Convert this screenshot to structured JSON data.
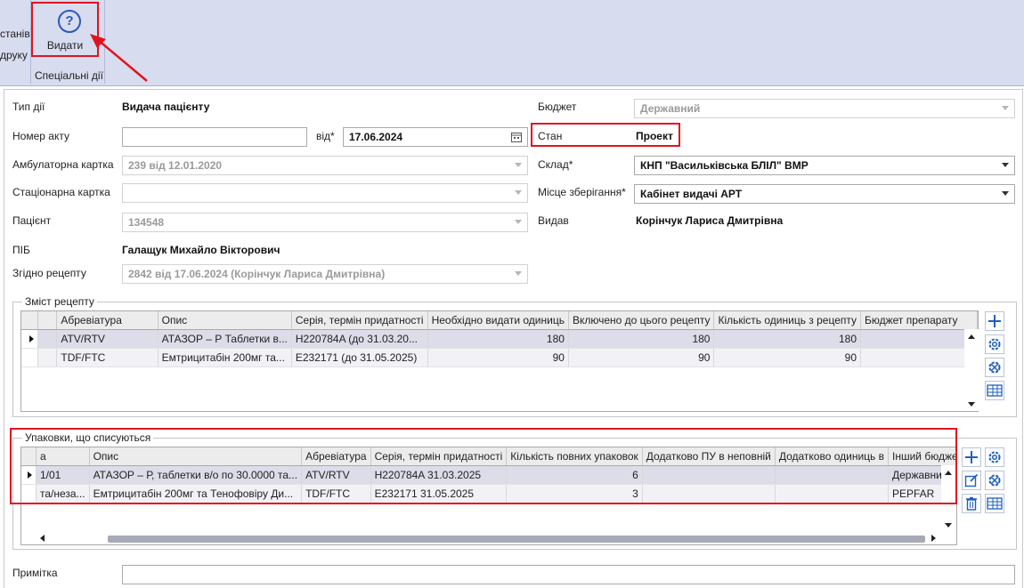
{
  "ribbon": {
    "left_line1": "станів",
    "left_line2": "друку",
    "issue_button_label": "Видати",
    "group_label": "Спеціальні дії"
  },
  "form": {
    "action_type_label": "Тип дії",
    "action_type_value": "Видача пацієнту",
    "act_number_label": "Номер акту",
    "act_number_value": "",
    "from_label": "від*",
    "date_value": "17.06.2024",
    "outpatient_label": "Амбулаторна картка",
    "outpatient_value": "239 від 12.01.2020",
    "inpatient_label": "Стаціонарна картка",
    "inpatient_value": "",
    "patient_label": "Пацієнт",
    "patient_value": "134548",
    "full_name_label": "ПІБ",
    "full_name_value": "Галащук Михайло Вікторович",
    "prescription_label": "Згідно рецепту",
    "prescription_value": "2842 від 17.06.2024 (Корінчук Лариса Дмитрівна)",
    "budget_label": "Бюджет",
    "budget_value": "Державний",
    "state_label": "Стан",
    "state_value": "Проект",
    "warehouse_label": "Склад*",
    "warehouse_value": "КНП \"Васильківська БЛІЛ\" ВМР",
    "storage_label": "Місце зберігання*",
    "storage_value": "Кабінет видачі АРТ",
    "issued_by_label": "Видав",
    "issued_by_value": "Корінчук Лариса Дмитрівна",
    "note_label": "Примітка",
    "note_value": ""
  },
  "recipe": {
    "title": "Зміст рецепту",
    "columns": [
      "Абревіатура",
      "Опис",
      "Серія, термін придатності",
      "Необхідно видати одиниць",
      "Включено до цього рецепту",
      "Кількість одиниць з рецепту",
      "Бюджет препарату"
    ],
    "rows": [
      [
        "ATV/RTV",
        "АТАЗОР – Р Таблетки в...",
        "H220784A (до 31.03.20...",
        "180",
        "180",
        "180",
        ""
      ],
      [
        "TDF/FTC",
        "Емтрицитабін 200мг та...",
        "E232171 (до 31.05.2025)",
        "90",
        "90",
        "90",
        ""
      ]
    ]
  },
  "packages": {
    "title": "Упаковки, що списуються",
    "columns": [
      "а",
      "Опис",
      "Абревіатура",
      "Серія, термін придатності",
      "Кількість повних упаковок",
      "Додатково ПУ в неповній",
      "Додатково одиниць в",
      "Інший бюджет"
    ],
    "rows": [
      [
        "1/01",
        "АТАЗОР – Р, таблетки в/о по 30.0000 та...",
        "ATV/RTV",
        "H220784A 31.03.2025",
        "6",
        "",
        "",
        "Державний"
      ],
      [
        "та/неза...",
        "Емтрицитабін 200мг та Тенофовіру Ди...",
        "TDF/FTC",
        "E232171 31.05.2025",
        "3",
        "",
        "",
        "PEPFAR"
      ]
    ]
  },
  "colors": {
    "ribbon_bg": "#d7dcef",
    "highlight_red": "#e0141e",
    "accent_blue": "#1f5fbf",
    "selected_row": "#dcdde8"
  }
}
